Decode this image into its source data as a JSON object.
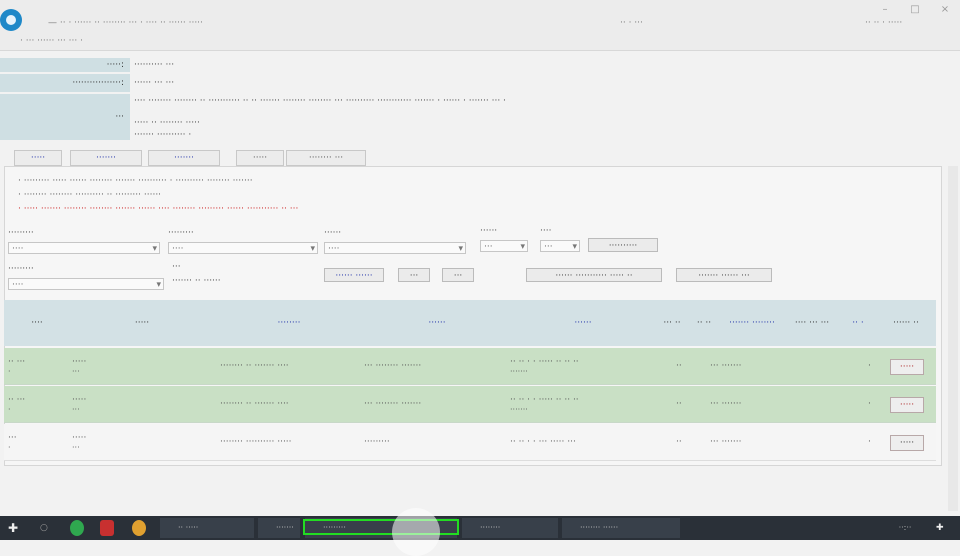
{
  "titlebar": {
    "app_title": "— ·· · ······ ·· ········ ··· · ···· ·· ······ ·····",
    "sub_title": "· ··· ······ ··· ··· ·",
    "right_text": "·· · ···",
    "right_text2": "·· ·· · ·····"
  },
  "summary": {
    "rows": [
      {
        "label": "·····:",
        "value": "·········· ···"
      },
      {
        "label": "·················:",
        "value": "······ ··· ···"
      },
      {
        "label": "···",
        "value": "···· ········ ········ ·· ··········· ·· ·· ·······  ········ ········ ··· ·········· ············ ······· · ······ · ······· ··· ·"
      }
    ],
    "extra_lines": [
      "····· ·· ········ ·····",
      "······· ·········· ·"
    ]
  },
  "tabs": [
    "·····",
    "·······",
    "·······",
    "·····",
    "········ ···"
  ],
  "notes": [
    "· ········· ····· ······ ········ ······· ·········· · ·········· ········ ·······",
    "· ········ ········ ·········· ·· ········· ······",
    "· ····· ······· ········ ········ ·······  ······ ···· ········ ········· ······ ··········· ·· ···"
  ],
  "filters": {
    "f1": {
      "label": "·········",
      "value": "····"
    },
    "f2": {
      "label": "·········",
      "value": "····"
    },
    "f3": {
      "label": "······",
      "value": "····"
    },
    "f4": {
      "label": "······",
      "value": "···"
    },
    "f5": {
      "label": "····",
      "value": "···"
    },
    "f6": {
      "label": "·········",
      "value": "····"
    },
    "f7": {
      "label": "···",
      "value": "······· ·· ······"
    },
    "num_a": "··",
    "num_b": "··"
  },
  "buttons": {
    "b1": "··········",
    "b2": "······ ······",
    "b3": "···",
    "b4": "···",
    "b5": "······ ··········· ····· ··",
    "b6": "······· ······ ···"
  },
  "table": {
    "headers": [
      "····",
      "·····",
      "········",
      "······",
      "······",
      "··· ··",
      "·· ··",
      "······· ········",
      "···· ··· ···",
      "·· ·",
      "······ ··"
    ],
    "rows": [
      {
        "c1": "·· ···",
        "c1b": "·",
        "c2": "·····",
        "c2b": "···",
        "c3": "········ ·· ······· ····",
        "c4": "··· ········ ·······",
        "c5": "·· ·· · · ····· ·· ·· ··",
        "c5b": "·······",
        "c6": "··",
        "c7": "··· ·······",
        "c8": "·",
        "btn": "·····"
      },
      {
        "c1": "·· ···",
        "c1b": "·",
        "c2": "·····",
        "c2b": "···",
        "c3": "········ ·· ······· ····",
        "c4": "··· ········ ·······",
        "c5": "·· ·· · · ····· ·· ·· ··",
        "c5b": "·······",
        "c6": "··",
        "c7": "··· ·······",
        "c8": "·",
        "btn": "·····"
      },
      {
        "c1": "···",
        "c1b": "·",
        "c2": "·····",
        "c2b": "···",
        "c3": "········ ·········· ·····",
        "c4": "·········",
        "c5": "·· ·· · · ··· ····· ···",
        "c5b": "",
        "c6": "··",
        "c7": "··· ·······",
        "c8": "·",
        "btn": "·····"
      }
    ]
  },
  "taskbar": {
    "app1": "·· ·····",
    "app2": "·······",
    "app3": "·········",
    "app4": "········",
    "app5": "········ ······",
    "clock": "··:··"
  },
  "colors": {
    "accent": "#2233aa",
    "warning": "#cc2222",
    "row_green": "#c9e0c5",
    "header_bg": "#d3e1e5",
    "highlight": "#22dd22"
  }
}
